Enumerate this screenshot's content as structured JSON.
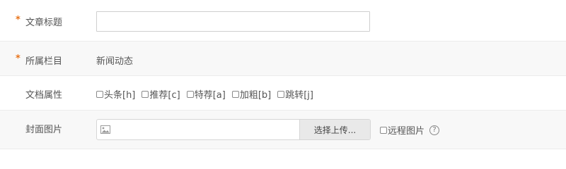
{
  "form": {
    "title_row": {
      "required_mark": "*",
      "label": "文章标题",
      "value": ""
    },
    "column_row": {
      "required_mark": "*",
      "label": "所属栏目",
      "value": "新闻动态"
    },
    "attr_row": {
      "label": "文档属性",
      "options": [
        {
          "label": "头条[h]",
          "checked": false
        },
        {
          "label": "推荐[c]",
          "checked": false
        },
        {
          "label": "特荐[a]",
          "checked": false
        },
        {
          "label": "加粗[b]",
          "checked": false
        },
        {
          "label": "跳转[j]",
          "checked": false
        }
      ]
    },
    "cover_row": {
      "label": "封面图片",
      "upload_button": "选择上传...",
      "remote_label": "远程图片",
      "remote_checked": false,
      "help_glyph": "?"
    }
  },
  "icons": {
    "image": "image-icon",
    "help": "help-circle-icon"
  },
  "colors": {
    "required": "#e8731a",
    "alt_row_bg": "#f8f8f8",
    "border": "#cfcfcf",
    "button_bg": "#e9e9e9"
  }
}
